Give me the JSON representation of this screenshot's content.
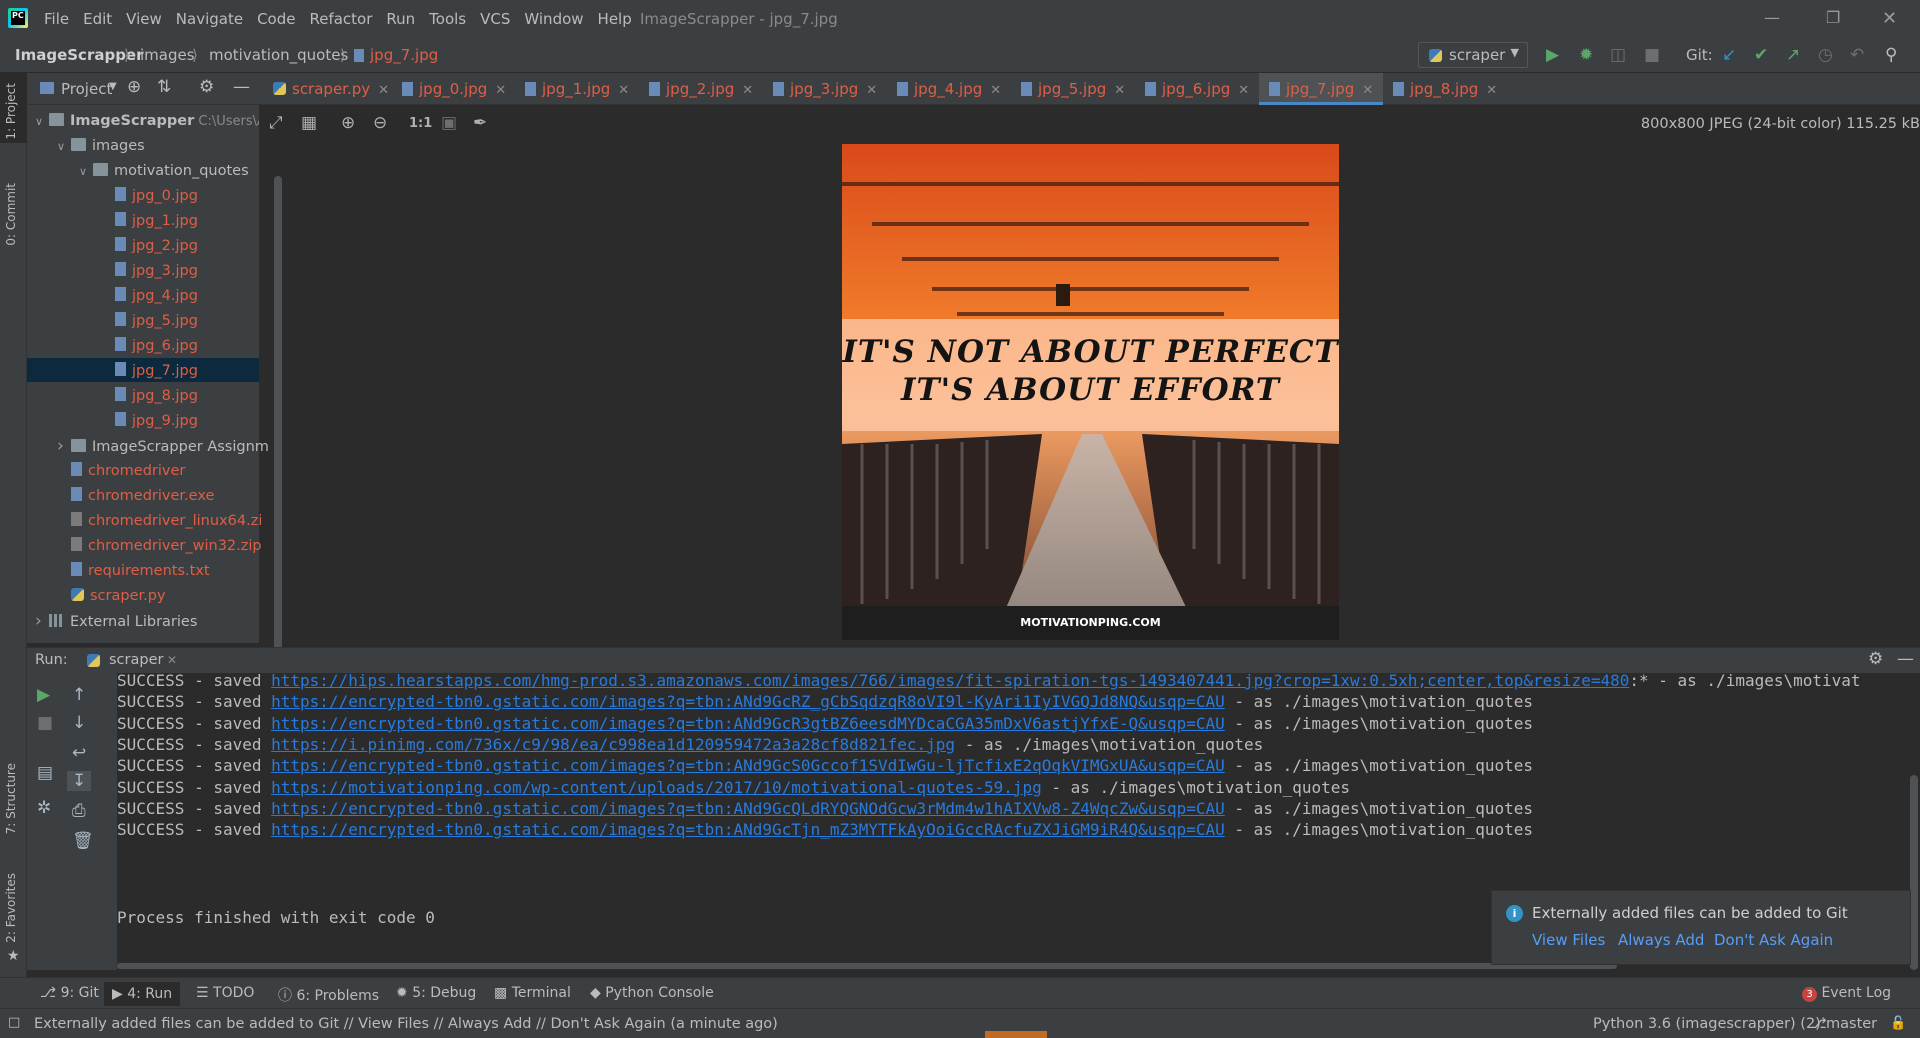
{
  "window": {
    "title": "ImageScrapper - jpg_7.jpg",
    "menu": [
      "File",
      "Edit",
      "View",
      "Navigate",
      "Code",
      "Refactor",
      "Run",
      "Tools",
      "VCS",
      "Window",
      "Help"
    ]
  },
  "breadcrumbs": [
    "ImageScrapper",
    "images",
    "motivation_quotes",
    "jpg_7.jpg"
  ],
  "run_config": "scraper",
  "git_label": "Git:",
  "left_stripe": {
    "project": "1: Project",
    "commit": "0: Commit",
    "structure": "7: Structure",
    "favorites": "2: Favorites"
  },
  "project_panel": {
    "title": "Project",
    "tree": [
      {
        "label": "ImageScrapper",
        "suffix": "C:\\Users\\A",
        "type": "folder",
        "bold": true,
        "level": 0,
        "expanded": true
      },
      {
        "label": "images",
        "type": "folder",
        "level": 1,
        "expanded": true
      },
      {
        "label": "motivation_quotes",
        "type": "folder",
        "level": 2,
        "expanded": true
      },
      {
        "label": "jpg_0.jpg",
        "type": "file",
        "level": 3
      },
      {
        "label": "jpg_1.jpg",
        "type": "file",
        "level": 3
      },
      {
        "label": "jpg_2.jpg",
        "type": "file",
        "level": 3
      },
      {
        "label": "jpg_3.jpg",
        "type": "file",
        "level": 3
      },
      {
        "label": "jpg_4.jpg",
        "type": "file",
        "level": 3
      },
      {
        "label": "jpg_5.jpg",
        "type": "file",
        "level": 3
      },
      {
        "label": "jpg_6.jpg",
        "type": "file",
        "level": 3
      },
      {
        "label": "jpg_7.jpg",
        "type": "file",
        "level": 3,
        "selected": true
      },
      {
        "label": "jpg_8.jpg",
        "type": "file",
        "level": 3
      },
      {
        "label": "jpg_9.jpg",
        "type": "file",
        "level": 3
      },
      {
        "label": "ImageScrapper Assignm",
        "type": "folder",
        "level": 1,
        "expanded": false
      },
      {
        "label": "chromedriver",
        "type": "file",
        "level": 1
      },
      {
        "label": "chromedriver.exe",
        "type": "file",
        "level": 1
      },
      {
        "label": "chromedriver_linux64.zi",
        "type": "zip",
        "level": 1
      },
      {
        "label": "chromedriver_win32.zip",
        "type": "zip",
        "level": 1
      },
      {
        "label": "requirements.txt",
        "type": "txt",
        "level": 1
      },
      {
        "label": "scraper.py",
        "type": "py",
        "level": 1
      },
      {
        "label": "External Libraries",
        "type": "lib",
        "level": 0,
        "expanded": false
      }
    ]
  },
  "editor_tabs": [
    "scraper.py",
    "jpg_0.jpg",
    "jpg_1.jpg",
    "jpg_2.jpg",
    "jpg_3.jpg",
    "jpg_4.jpg",
    "jpg_5.jpg",
    "jpg_6.jpg",
    "jpg_7.jpg",
    "jpg_8.jpg"
  ],
  "active_tab": "jpg_7.jpg",
  "image_viewer": {
    "zoom_label": "1:1",
    "info": "800x800 JPEG (24-bit color) 115.25 kB",
    "quote_line1": "IT'S NOT ABOUT PERFECT",
    "quote_line2": "IT'S ABOUT EFFORT",
    "caption": "MOTIVATIONPING.COM"
  },
  "run_panel": {
    "label": "Run:",
    "tab": "scraper",
    "lines": [
      {
        "prefix": "SUCCESS - saved ",
        "url": "https://hips.hearstapps.com/hmg-prod.s3.amazonaws.com/images/766/images/fit-spiration-tgs-1493407441.jpg?crop=1xw:0.5xh;center,top&resize=480",
        "suffix": ":* - as ./images\\motivat"
      },
      {
        "prefix": "SUCCESS - saved ",
        "url": "https://encrypted-tbn0.gstatic.com/images?q=tbn:ANd9GcRZ_gCbSqdzqR8oVI9l-KyAri1IyIVGQJd8NQ&usqp=CAU",
        "suffix": " - as ./images\\motivation_quotes"
      },
      {
        "prefix": "SUCCESS - saved ",
        "url": "https://encrypted-tbn0.gstatic.com/images?q=tbn:ANd9GcR3gtBZ6eesdMYDcaCGA35mDxV6astjYfxE-Q&usqp=CAU",
        "suffix": " - as ./images\\motivation_quotes"
      },
      {
        "prefix": "SUCCESS - saved ",
        "url": "https://i.pinimg.com/736x/c9/98/ea/c998ea1d120959472a3a28cf8d821fec.jpg",
        "suffix": " - as ./images\\motivation_quotes"
      },
      {
        "prefix": "SUCCESS - saved ",
        "url": "https://encrypted-tbn0.gstatic.com/images?q=tbn:ANd9GcS0Gccof1SVdIwGu-ljTcfixE2qOqkVIMGxUA&usqp=CAU",
        "suffix": " - as ./images\\motivation_quotes"
      },
      {
        "prefix": "SUCCESS - saved ",
        "url": "https://motivationping.com/wp-content/uploads/2017/10/motivational-quotes-59.jpg",
        "suffix": " - as ./images\\motivation_quotes"
      },
      {
        "prefix": "SUCCESS - saved ",
        "url": "https://encrypted-tbn0.gstatic.com/images?q=tbn:ANd9GcQLdRYQGNOdGcw3rMdm4w1hAIXVw8-Z4WqcZw&usqp=CAU",
        "suffix": " - as ./images\\motivation_quotes"
      },
      {
        "prefix": "SUCCESS - saved ",
        "url": "https://encrypted-tbn0.gstatic.com/images?q=tbn:ANd9GcTjn_mZ3MYTFkAyOoiGccRAcfuZXJiGM9iR4Q&usqp=CAU",
        "suffix": " - as ./images\\motivation_quotes"
      }
    ],
    "exit_line": "Process finished with exit code 0"
  },
  "notification": {
    "text": "Externally added files can be added to Git",
    "actions": [
      "View Files",
      "Always Add",
      "Don't Ask Again"
    ]
  },
  "tool_windows": {
    "git": "9: Git",
    "run": "4: Run",
    "todo": "TODO",
    "problems": "6: Problems",
    "debug": "5: Debug",
    "terminal": "Terminal",
    "python_console": "Python Console",
    "event_log": "Event Log",
    "event_count": "3"
  },
  "status_bar": {
    "message": "Externally added files can be added to Git // View Files // Always Add // Don't Ask Again (a minute ago)",
    "interpreter": "Python 3.6 (imagescrapper) (2)",
    "branch": "master"
  },
  "colors": {
    "accent": "#4a88c7",
    "link": "#287bde",
    "modified_file": "#e05e45",
    "run_green": "#59a869"
  }
}
